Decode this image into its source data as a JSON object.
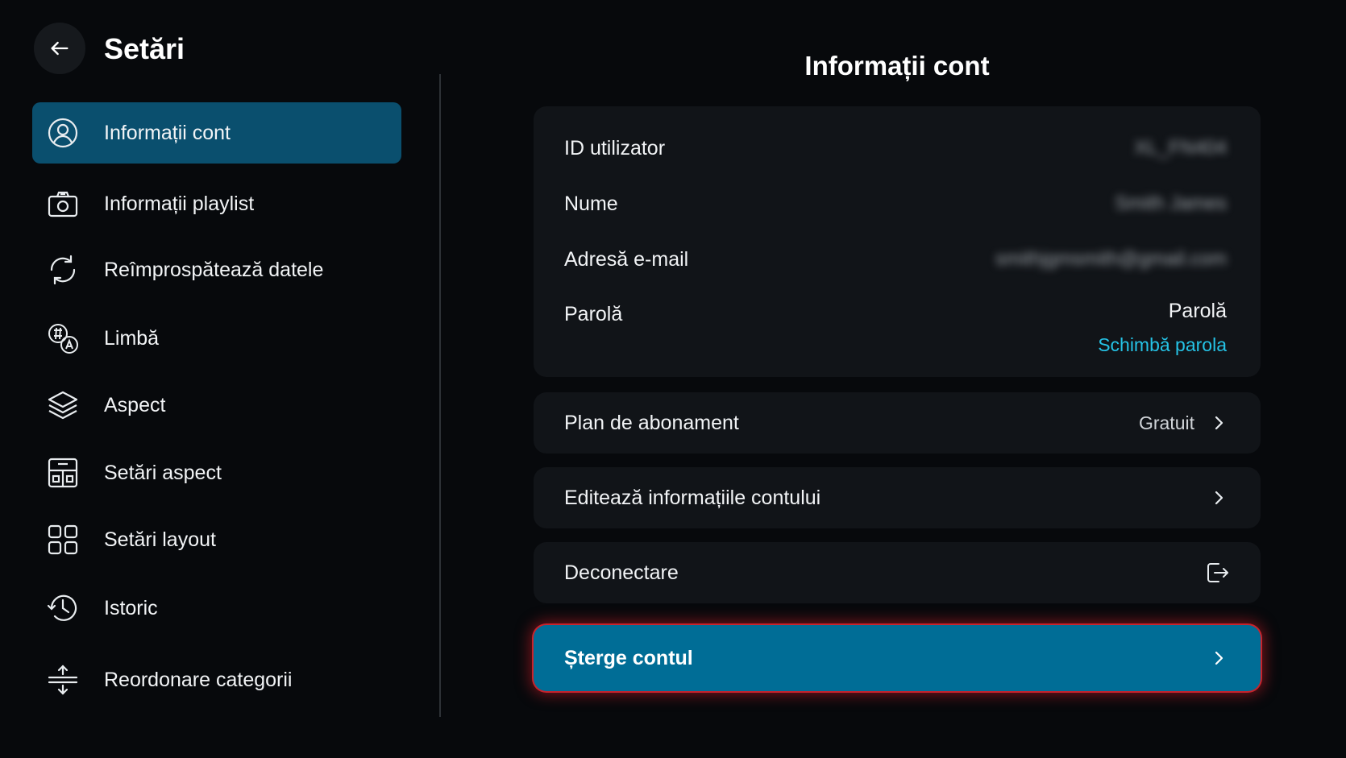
{
  "header": {
    "title": "Setări"
  },
  "sidebar": {
    "items": [
      {
        "label": "Informații cont",
        "icon": "user-circle-icon",
        "active": true
      },
      {
        "label": "Informații playlist",
        "icon": "camera-icon"
      },
      {
        "label": "Reîmprospătează datele",
        "icon": "refresh-icon"
      },
      {
        "label": "Limbă",
        "icon": "language-icon"
      },
      {
        "label": "Aspect",
        "icon": "layers-icon"
      },
      {
        "label": "Setări aspect",
        "icon": "layout-settings-icon"
      },
      {
        "label": "Setări layout",
        "icon": "grid-icon"
      },
      {
        "label": "Istoric",
        "icon": "history-icon"
      },
      {
        "label": "Reordonare categorii",
        "icon": "reorder-icon"
      }
    ]
  },
  "main": {
    "title": "Informații cont",
    "info": {
      "user_id_label": "ID utilizator",
      "user_id_value": "XL_FN404",
      "name_label": "Nume",
      "name_value": "Smith James",
      "email_label": "Adresă e-mail",
      "email_value": "smithjgmsmith@gmail.com",
      "password_label": "Parolă",
      "password_value": "Parolă",
      "change_password": "Schimbă parola"
    },
    "subscription": {
      "label": "Plan de abonament",
      "value": "Gratuit"
    },
    "edit_account": {
      "label": "Editează informațiile contului"
    },
    "logout": {
      "label": "Deconectare"
    },
    "delete_account": {
      "label": "Șterge contul"
    }
  },
  "colors": {
    "active_item": "#0a4f6e",
    "link": "#25c3e6",
    "danger_button": "#006d96",
    "danger_glow": "#c8232c"
  }
}
